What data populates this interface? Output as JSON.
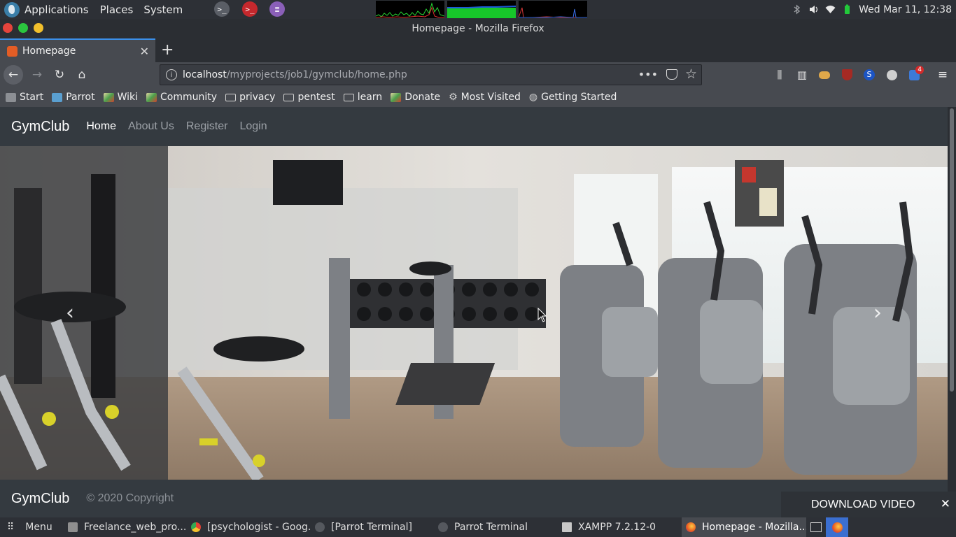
{
  "system_panel": {
    "menus": [
      "Applications",
      "Places",
      "System"
    ],
    "clock": "Wed Mar 11, 12:38"
  },
  "window": {
    "title": "Homepage - Mozilla Firefox"
  },
  "browser": {
    "tab_title": "Homepage",
    "url_host": "localhost",
    "url_path": "/myprojects/job1/gymclub/home.php",
    "notification_badge": "4",
    "bookmarks": [
      "Start",
      "Parrot",
      "Wiki",
      "Community",
      "privacy",
      "pentest",
      "learn",
      "Donate",
      "Most Visited",
      "Getting Started"
    ]
  },
  "site": {
    "brand": "GymClub",
    "nav": [
      "Home",
      "About Us",
      "Register",
      "Login"
    ],
    "footer_brand": "GymClub",
    "copyright": "© 2020 Copyright"
  },
  "download_popup": {
    "label": "DOWNLOAD VIDEO"
  },
  "taskbar": {
    "menu_label": "Menu",
    "tasks": [
      "Freelance_web_pro...",
      "[psychologist - Goog...",
      "[Parrot Terminal]",
      "Parrot Terminal",
      "XAMPP 7.2.12-0",
      "Homepage - Mozilla..."
    ]
  }
}
